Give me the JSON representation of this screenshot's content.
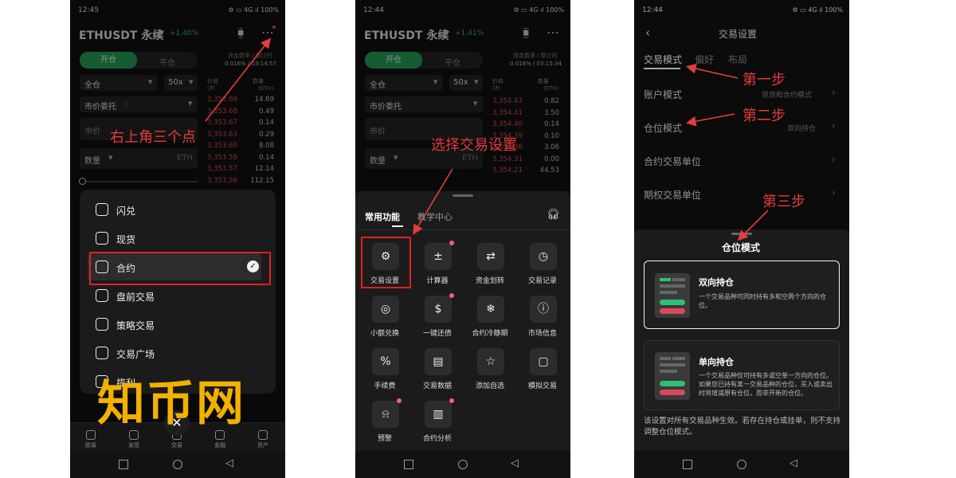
{
  "p1": {
    "status_time": "12:45",
    "status_right": "⚙ ▭ 4G ıl 100%",
    "symbol": "ETHUSDT 永续",
    "change": "+1.40%",
    "tab_open": "开仓",
    "tab_close": "平仓",
    "funding_label": "资金费率 / 倒计时",
    "funding_value": "0.016% / 03:14:57",
    "margin_mode": "全仓",
    "leverage": "50x",
    "order_type": "市价委托",
    "price_label": "市价",
    "qty_label": "数量",
    "qty_unit": "ETH",
    "price_header": "价格",
    "price_unit": "(₮)",
    "qty_header": "数量",
    "qty_unit_h": "(ETH)",
    "asks": [
      [
        "3,353.69",
        "14.69"
      ],
      [
        "3,353.68",
        "0.49"
      ],
      [
        "3,353.67",
        "0.14"
      ],
      [
        "3,353.63",
        "0.29"
      ],
      [
        "3,353.60",
        "8.08"
      ],
      [
        "3,353.59",
        "0.14"
      ],
      [
        "3,353.57",
        "12.14"
      ],
      [
        "3,353.56",
        "112.15"
      ]
    ],
    "menu": [
      "闪兑",
      "现货",
      "合约",
      "盘前交易",
      "策略交易",
      "交易广场",
      "揽利"
    ],
    "tabs": [
      "欧易",
      "发现",
      "交易",
      "金融",
      "资产"
    ],
    "annotation": "右上角三个点",
    "watermark": "知币网"
  },
  "p2": {
    "status_time": "12:44",
    "status_right": "⚙ ▭ 4G ıl 100%",
    "symbol": "ETHUSDT 永续",
    "change": "+1.41%",
    "tab_open": "开仓",
    "tab_close": "平仓",
    "funding_label": "资金费率 / 倒计时",
    "funding_value": "0.016% / 03:15:34",
    "margin_mode": "全仓",
    "leverage": "50x",
    "order_type": "市价委托",
    "price_label": "市价",
    "qty_label": "数量",
    "qty_unit": "ETH",
    "price_header": "价格",
    "price_unit": "(₮)",
    "qty_header": "数量",
    "qty_unit_h": "(ETH)",
    "asks": [
      [
        "3,354.43",
        "0.82"
      ],
      [
        "3,354.41",
        "3.50"
      ],
      [
        "3,354.40",
        "0.14"
      ],
      [
        "3,354.39",
        "0.10"
      ],
      [
        "3,354.36",
        "3.06"
      ],
      [
        "3,354.31",
        "0.00"
      ],
      [
        "3,354.21",
        "44.53"
      ]
    ],
    "sheet_tab1": "常用功能",
    "sheet_tab2": "教学中心",
    "grid": [
      "交易设置",
      "计算器",
      "资金划转",
      "交易记录",
      "小额兑换",
      "一键还债",
      "合约冷静期",
      "市场信息",
      "手续费",
      "交易数据",
      "添加自选",
      "模拟交易",
      "预警",
      "合约分析"
    ],
    "annotation": "选择交易设置"
  },
  "p3": {
    "status_time": "12:44",
    "status_right": "⚙ ▭ 4G ıl 100%",
    "title": "交易设置",
    "tabs": [
      "交易模式",
      "偏好",
      "布局"
    ],
    "row1": "账户模式",
    "row1_val": "现货和合约模式",
    "row2": "仓位模式",
    "row2_val": "双向持仓",
    "row3": "合约交易单位",
    "row4": "期权交易单位",
    "sheet_title": "仓位模式",
    "opt1_title": "双向持仓",
    "opt1_desc": "一个交易品种可同时持有多和空两个方向的仓位。",
    "opt2_title": "单向持仓",
    "opt2_desc": "一个交易品种仅可持有多或空单一方向的仓位。如果您已持有某一交易品种的仓位，买入或卖出时将增减原有仓位，而非开新的仓位。",
    "note": "该设置对所有交易品种生效。若存在持仓或挂单，则不支持调整仓位模式。",
    "step1": "第一步",
    "step2": "第二步",
    "step3": "第三步"
  }
}
